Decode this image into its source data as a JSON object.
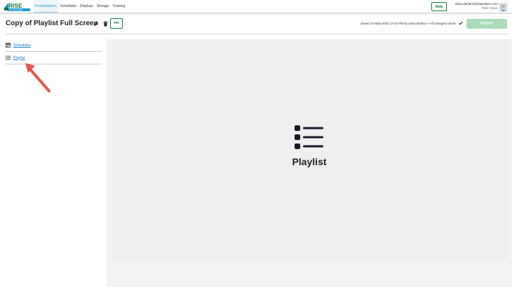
{
  "brand": {
    "logo_text": "RISE",
    "logo_subtext": "VISION",
    "colors": {
      "green": "#107a3a",
      "light_green": "#a9dcb9",
      "link_blue": "#1a7ac9",
      "arrow_red": "#e8574a"
    }
  },
  "nav": {
    "links": [
      "Presentations",
      "Schedules",
      "Displays",
      "Storage",
      "Training"
    ],
    "active": "Presentations",
    "help_label": "Help",
    "user_email": "shea.darlison@risevision.com",
    "user_company": "Rise Vision"
  },
  "editor": {
    "title": "Copy of Playlist Full Screen",
    "edit_icon": "pencil-icon",
    "delete_icon": "trash-icon",
    "more_label": "•••",
    "saved_text": "Saved 24-May-2022 12:43 PM by shea.darlison • All changes saved",
    "publish_label": "Publish"
  },
  "sidebar": {
    "items": [
      {
        "label": "Schedules",
        "icon": "calendar-icon"
      },
      {
        "label": "Playlist",
        "icon": "list-icon"
      }
    ]
  },
  "main": {
    "heading": "Playlist",
    "icon": "playlist-icon"
  }
}
